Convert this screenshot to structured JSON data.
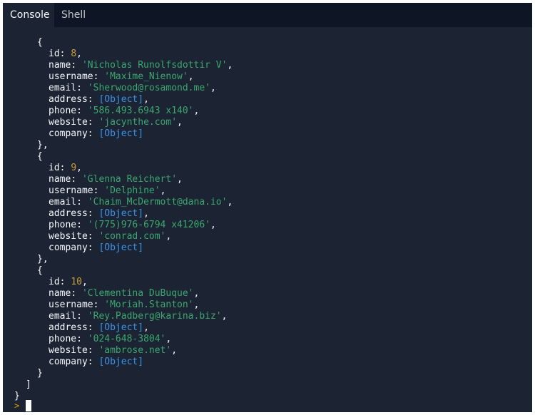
{
  "tabs": {
    "console": "Console",
    "shell": "Shell"
  },
  "prompt_symbol": ">",
  "records": [
    {
      "id": "8",
      "name": "'Nicholas Runolfsdottir V'",
      "username": "'Maxime_Nienow'",
      "email": "'Sherwood@rosamond.me'",
      "address": "[Object]",
      "phone": "'586.493.6943 x140'",
      "website": "'jacynthe.com'",
      "company": "[Object]"
    },
    {
      "id": "9",
      "name": "'Glenna Reichert'",
      "username": "'Delphine'",
      "email": "'Chaim_McDermott@dana.io'",
      "address": "[Object]",
      "phone": "'(775)976-6794 x41206'",
      "website": "'conrad.com'",
      "company": "[Object]"
    },
    {
      "id": "10",
      "name": "'Clementina DuBuque'",
      "username": "'Moriah.Stanton'",
      "email": "'Rey.Padberg@karina.biz'",
      "address": "[Object]",
      "phone": "'024-648-3804'",
      "website": "'ambrose.net'",
      "company": "[Object]"
    }
  ],
  "keys": {
    "id": "id",
    "name": "name",
    "username": "username",
    "email": "email",
    "address": "address",
    "phone": "phone",
    "website": "website",
    "company": "company"
  },
  "colors": {
    "background": "#1c2333",
    "tabbar": "#0e1525",
    "key": "#f5f9fc",
    "number": "#c9a03f",
    "string": "#3ba86f",
    "object": "#3a92e6",
    "prompt": "#d9a300"
  }
}
